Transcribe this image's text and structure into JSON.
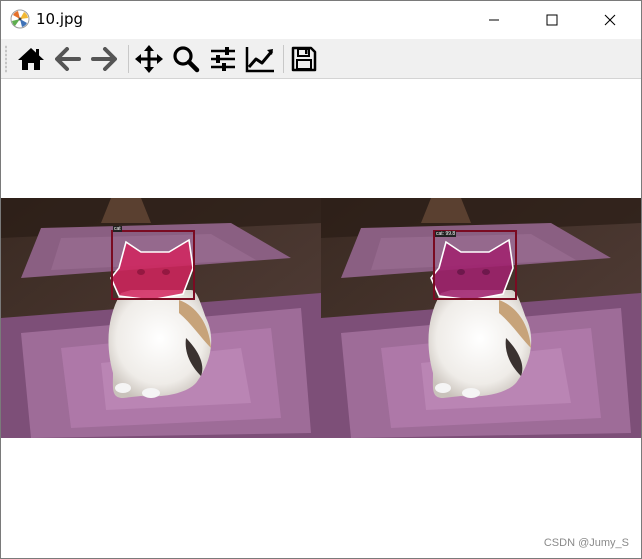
{
  "window": {
    "title": "10.jpg",
    "controls": [
      "minimize-icon",
      "maximize-icon",
      "close-icon"
    ]
  },
  "toolbar": {
    "tools": [
      {
        "icon": "home-icon"
      },
      {
        "icon": "back-arrow-icon"
      },
      {
        "icon": "forward-arrow-icon"
      },
      {
        "icon": "pan-icon"
      },
      {
        "icon": "zoom-icon"
      },
      {
        "icon": "subplots-config-icon"
      },
      {
        "icon": "edit-axis-icon"
      },
      {
        "icon": "save-icon"
      }
    ]
  },
  "figure": {
    "left_panel": {
      "label": "cat"
    },
    "right_panel": {
      "label": "cat: 99.8"
    }
  },
  "watermark": "CSDN @Jumy_S",
  "colors": {
    "toolbar_bg": "#f0f0f0",
    "mask_left": "#d2245e",
    "mask_right": "#a0226e",
    "box": "#7a0b22"
  }
}
